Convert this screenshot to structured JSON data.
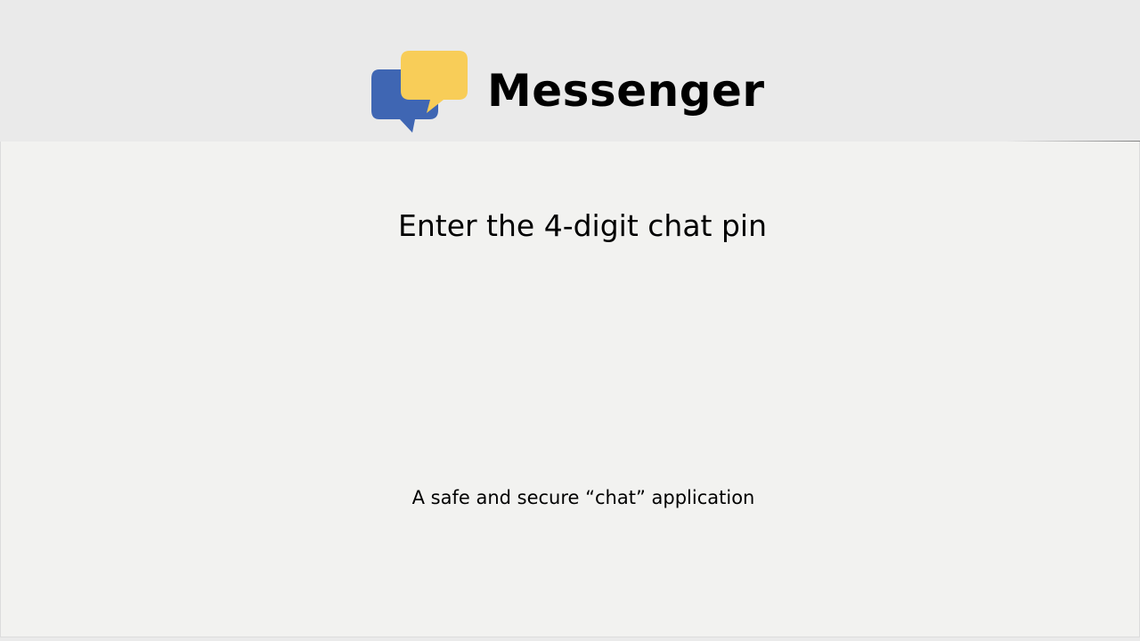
{
  "header": {
    "app_title": "Messenger",
    "logo": {
      "icon": "chat-bubbles-icon",
      "colors": {
        "front_bubble": "#f8cd58",
        "back_bubble": "#3f66b3"
      }
    }
  },
  "main": {
    "heading": "Enter the 4-digit chat pin",
    "tagline": "A safe and secure “chat” application"
  },
  "colors": {
    "header_background": "#eaeaea",
    "main_background": "#f2f2f0",
    "text": "#000000"
  }
}
